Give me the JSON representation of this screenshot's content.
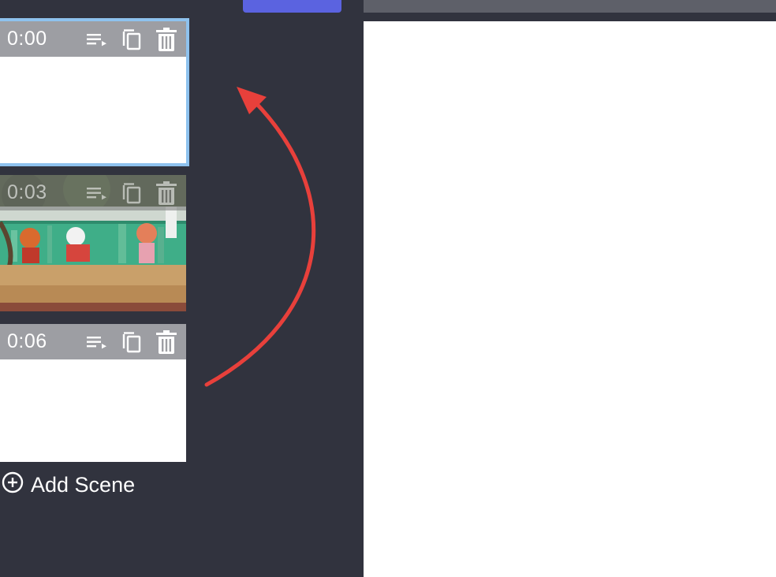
{
  "scenes": [
    {
      "time": "0:00",
      "selected": true,
      "thumbnail": "blank"
    },
    {
      "time": "0:03",
      "selected": false,
      "thumbnail": "graffiti-wall-photo"
    },
    {
      "time": "0:06",
      "selected": false,
      "thumbnail": "blank"
    }
  ],
  "add_scene": {
    "label": "Add Scene",
    "icon": "plus-circle-icon"
  },
  "scene_icons": [
    "reorder-icon",
    "duplicate-icon",
    "trash-icon"
  ],
  "colors": {
    "background": "#31333e",
    "selected_outline": "#8ec2ee",
    "primary_button": "#5b63e0",
    "annotation_arrow": "#e8403b",
    "scene_header": "#9d9ea3"
  }
}
